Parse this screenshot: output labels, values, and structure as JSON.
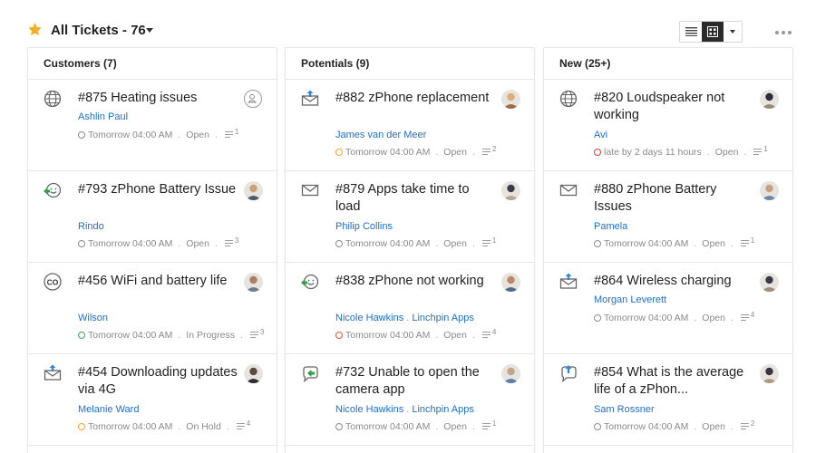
{
  "header": {
    "title": "All Tickets - 76",
    "colors": {
      "star": "#f2b01e",
      "link": "#1f6fc5",
      "active_view": "#2b2b2b"
    }
  },
  "columns": [
    {
      "title": "Customers (7)",
      "cards": [
        {
          "subject": "#875 Heating issues",
          "contact": "Ashlin Paul",
          "account": "",
          "time": "Tomorrow 04:00 AM",
          "status": "Open",
          "threads": "1",
          "channel_icon": "globe-icon",
          "clock_color": "#8a8a8a",
          "assignee": "unassigned-icon"
        },
        {
          "subject": "#793 zPhone Battery Issue",
          "contact": "Rindo",
          "account": "",
          "time": "Tomorrow 04:00 AM",
          "status": "Open",
          "threads": "3",
          "channel_icon": "happy-chat-icon",
          "clock_color": "#8a8a8a",
          "assignee": "avatar"
        },
        {
          "subject": "#456 WiFi and battery life",
          "contact": "Wilson",
          "account": "",
          "time": "Tomorrow 04:00 AM",
          "status": "In Progress",
          "threads": "3",
          "channel_icon": "co-icon",
          "clock_color": "#3aa655",
          "assignee": "avatar"
        },
        {
          "subject": "#454 Downloading updates via 4G",
          "contact": "Melanie Ward",
          "account": "",
          "time": "Tomorrow 04:00 AM",
          "status": "On Hold",
          "threads": "4",
          "channel_icon": "mail-reply-icon",
          "clock_color": "#f2a52b",
          "assignee": "avatar"
        }
      ]
    },
    {
      "title": "Potentials (9)",
      "cards": [
        {
          "subject": "#882 zPhone replacement",
          "contact": "James van der Meer",
          "account": "",
          "time": "Tomorrow 04:00 AM",
          "status": "Open",
          "threads": "2",
          "channel_icon": "mail-reply-icon",
          "clock_color": "#f2a52b",
          "assignee": "avatar"
        },
        {
          "subject": "#879 Apps take time to load",
          "contact": "Philip Collins",
          "account": "",
          "time": "Tomorrow 04:00 AM",
          "status": "Open",
          "threads": "1",
          "channel_icon": "mail-icon",
          "clock_color": "#8a8a8a",
          "assignee": "avatar"
        },
        {
          "subject": "#838 zPhone not working",
          "contact": "Nicole Hawkins",
          "account": "Linchpin Apps",
          "time": "Tomorrow 04:00 AM",
          "status": "Open",
          "threads": "4",
          "channel_icon": "happy-chat-icon",
          "clock_color": "#e0553a",
          "assignee": "avatar"
        },
        {
          "subject": "#732 Unable to open the camera app",
          "contact": "Nicole Hawkins",
          "account": "Linchpin Apps",
          "time": "Tomorrow 04:00 AM",
          "status": "Open",
          "threads": "1",
          "channel_icon": "chat-reply-icon",
          "clock_color": "#8a8a8a",
          "assignee": "avatar"
        }
      ]
    },
    {
      "title": "New (25+)",
      "cards": [
        {
          "subject": "#820 Loudspeaker not working",
          "contact": "Avi",
          "account": "",
          "time": "late by 2 days 11 hours",
          "status": "Open",
          "threads": "1",
          "channel_icon": "globe-icon",
          "clock_color": "#e03a3a",
          "assignee": "avatar"
        },
        {
          "subject": "#880 zPhone Battery Issues",
          "contact": "Pamela",
          "account": "",
          "time": "Tomorrow 04:00 AM",
          "status": "Open",
          "threads": "1",
          "channel_icon": "mail-icon",
          "clock_color": "#8a8a8a",
          "assignee": "avatar"
        },
        {
          "subject": "#864 Wireless charging",
          "contact": "Morgan Leverett",
          "account": "",
          "time": "Tomorrow 04:00 AM",
          "status": "Open",
          "threads": "4",
          "channel_icon": "mail-reply-icon",
          "clock_color": "#8a8a8a",
          "assignee": "avatar"
        },
        {
          "subject": "#854 What is the average life of a zPhon...",
          "contact": "Sam Rossner",
          "account": "",
          "time": "Tomorrow 04:00 AM",
          "status": "Open",
          "threads": "2",
          "channel_icon": "chat-question-icon",
          "clock_color": "#8a8a8a",
          "assignee": "avatar"
        }
      ]
    }
  ]
}
